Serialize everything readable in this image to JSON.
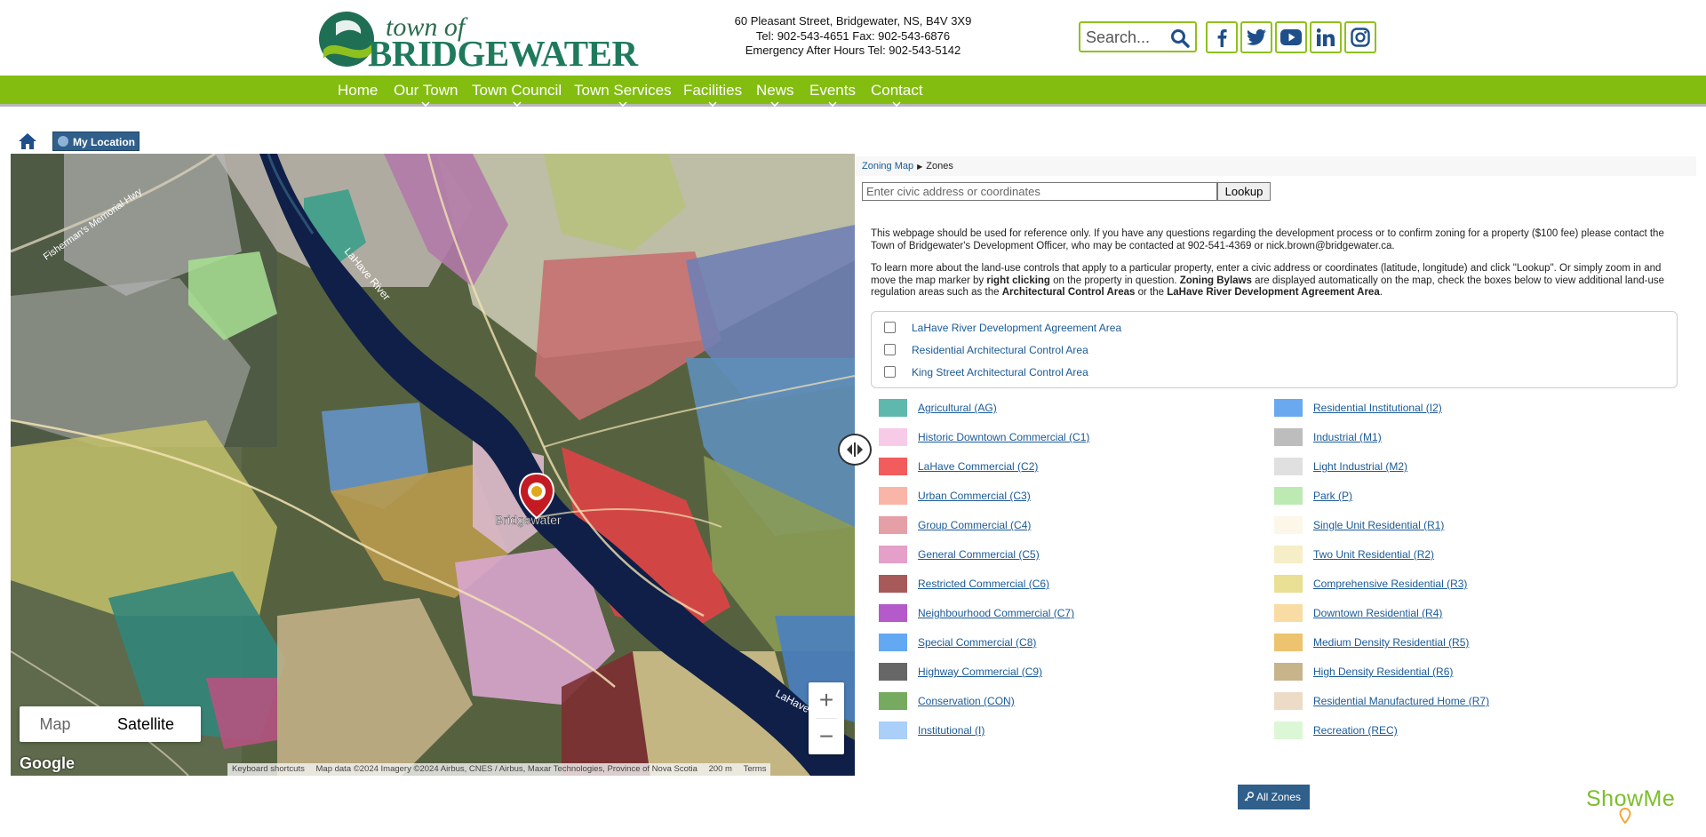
{
  "header": {
    "logo_top": "town of",
    "logo_name": "BRIDGEWATER",
    "address": "60 Pleasant Street, Bridgewater, NS, B4V 3X9",
    "phone": "Tel: 902-543-4651 Fax: 902-543-6876",
    "emergency": "Emergency After Hours Tel: 902-543-5142",
    "search_placeholder": "Search...",
    "social": [
      "facebook-icon",
      "twitter-icon",
      "youtube-icon",
      "linkedin-icon",
      "instagram-icon"
    ]
  },
  "nav": {
    "items": [
      "Home",
      "Our Town",
      "Town Council",
      "Town Services",
      "Facilities",
      "News",
      "Events",
      "Contact"
    ]
  },
  "toolbar": {
    "my_location": "My Location"
  },
  "map": {
    "type_map": "Map",
    "type_satellite": "Satellite",
    "active_type": "Satellite",
    "labels": {
      "town": "Bridgewater",
      "river": "LaHave River",
      "highway": "Fisherman's Memorial Hwy"
    },
    "google": "Google",
    "attribution": {
      "shortcuts": "Keyboard shortcuts",
      "data": "Map data ©2024 Imagery ©2024 Airbus, CNES / Airbus, Maxar Technologies, Province of Nova Scotia",
      "scale": "200 m",
      "terms": "Terms"
    }
  },
  "panel": {
    "breadcrumb_root": "Zoning Map",
    "breadcrumb_current": "Zones",
    "lookup_placeholder": "Enter civic address or coordinates",
    "lookup_button": "Lookup",
    "info1": "This webpage should be used for reference only. If you have any questions regarding the development process or to confirm zoning for a property ($100 fee) please contact the Town of Bridgewater's Development Officer, who may be contacted at 902-541-4369 or nick.brown@bridgewater.ca.",
    "info2_a": "To learn more about the land-use controls that apply to a particular property, enter a civic address or coordinates (latitude, longitude) and click \"Lookup\". Or simply zoom in and move the map marker by ",
    "info2_b": "right clicking",
    "info2_c": " on the property in question. ",
    "info2_d": "Zoning Bylaws",
    "info2_e": " are displayed automatically on the map, check the boxes below to view additional land-use regulation areas such as the ",
    "info2_f": "Architectural Control Areas",
    "info2_g": " or the ",
    "info2_h": "LaHave River Development Agreement Area",
    "info2_i": ".",
    "overlays": [
      "LaHave River Development Agreement Area",
      "Residential Architectural Control Area",
      "King Street Architectural Control Area"
    ],
    "zones_left": [
      {
        "label": "Agricultural (AG)",
        "color": "#5fb8ae"
      },
      {
        "label": "Historic Downtown Commercial (C1)",
        "color": "#f7cbe8"
      },
      {
        "label": "LaHave Commercial (C2)",
        "color": "#f25c5c"
      },
      {
        "label": "Urban Commercial (C3)",
        "color": "#f9b5a8"
      },
      {
        "label": "Group Commercial (C4)",
        "color": "#e4a0a6"
      },
      {
        "label": "General Commercial (C5)",
        "color": "#e4a0c8"
      },
      {
        "label": "Restricted Commercial (C6)",
        "color": "#a85a5a"
      },
      {
        "label": "Neighbourhood Commercial (C7)",
        "color": "#b45acb"
      },
      {
        "label": "Special Commercial (C8)",
        "color": "#62a8f2"
      },
      {
        "label": "Highway Commercial (C9)",
        "color": "#676767"
      },
      {
        "label": "Conservation (CON)",
        "color": "#76ab5f"
      },
      {
        "label": "Institutional (I)",
        "color": "#aacff8"
      }
    ],
    "zones_right": [
      {
        "label": "Residential Institutional (I2)",
        "color": "#6aa9ef"
      },
      {
        "label": "Industrial (M1)",
        "color": "#bdbdbd"
      },
      {
        "label": "Light Industrial (M2)",
        "color": "#e0e0e0"
      },
      {
        "label": "Park (P)",
        "color": "#bdeab2"
      },
      {
        "label": "Single Unit Residential (R1)",
        "color": "#fdf7ea"
      },
      {
        "label": "Two Unit Residential (R2)",
        "color": "#f5eec7"
      },
      {
        "label": "Comprehensive Residential (R3)",
        "color": "#e9df95"
      },
      {
        "label": "Downtown Residential (R4)",
        "color": "#f9dca3"
      },
      {
        "label": "Medium Density Residential (R5)",
        "color": "#ecc36e"
      },
      {
        "label": "High Density Residential (R6)",
        "color": "#c8b48b"
      },
      {
        "label": "Residential Manufactured Home (R7)",
        "color": "#ecdcc7"
      },
      {
        "label": "Recreation (REC)",
        "color": "#dcf7d6"
      }
    ],
    "all_zones": "All Zones",
    "brand": "ShowMe"
  },
  "colors": {
    "brand_green": "#83bd10",
    "button_blue": "#2f5f8a",
    "link_blue": "#1a5a96"
  }
}
